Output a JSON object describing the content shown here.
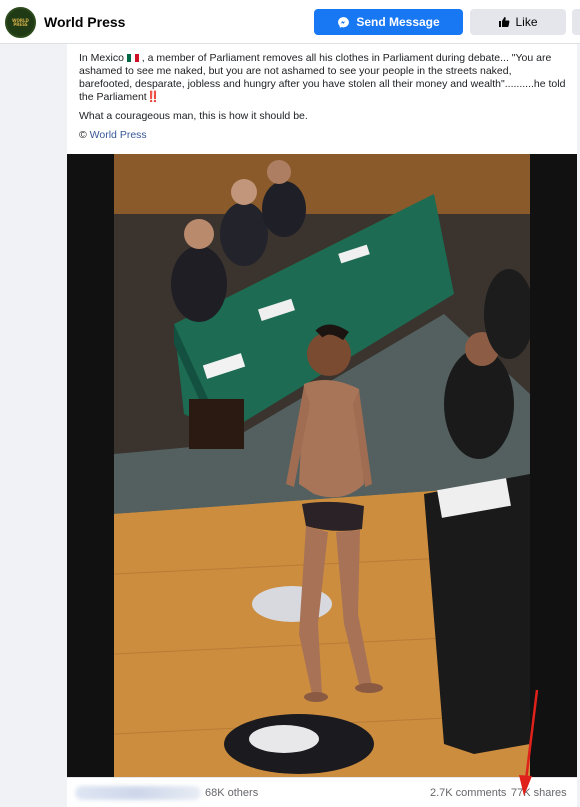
{
  "header": {
    "page_name": "World Press",
    "logo_text": "WORLD PRESS",
    "send_message_label": "Send Message",
    "like_label": "Like"
  },
  "post": {
    "text_part1": "In Mexico",
    "text_part2": ", a member of Parliament removes all his clothes in Parliament during debate... \"You are ashamed to see me naked, but you are not ashamed to see your people in the streets naked, barefooted, desparate, jobless and hungry after you have stolen all their money and wealth\"..........he told the Parliament",
    "text_emphasis": "‼️",
    "second_paragraph": "What a courageous man, this is how it should be.",
    "credit_symbol": "©",
    "credit_link": "World Press"
  },
  "footer": {
    "reactions": "68K others",
    "comments": "2.7K comments",
    "shares": "77K shares"
  },
  "colors": {
    "accent": "#1877f2",
    "annotation_arrow": "#e0201b"
  }
}
